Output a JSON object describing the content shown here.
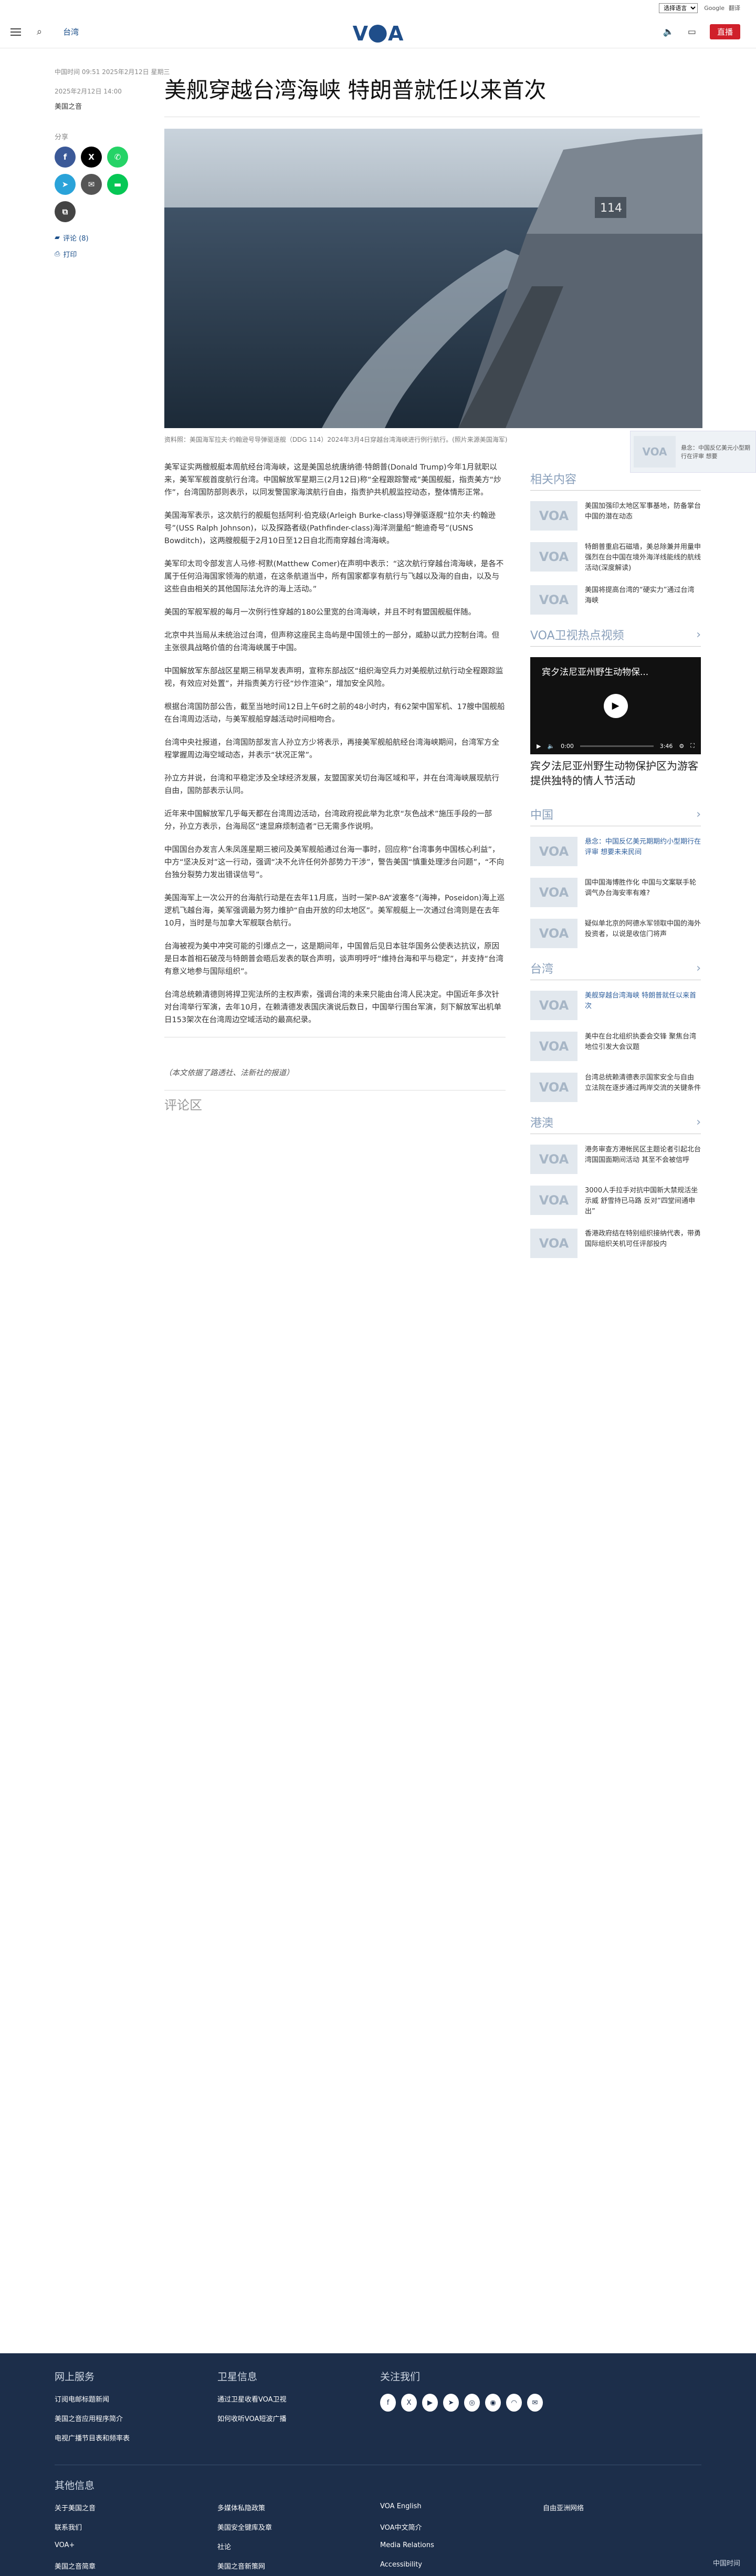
{
  "topbar": {
    "language": "选择语言",
    "google_label": "Google",
    "translate_label": "翻译"
  },
  "header": {
    "section": "台湾",
    "logo": "VOA",
    "live": "直播"
  },
  "article": {
    "meta": "中国时间 09:51 2025年2月12日 星期三",
    "date": "2025年2月12日 14:00",
    "author": "美国之音",
    "title": "美舰穿越台湾海峡 特朗普就任以来首次",
    "share_label": "分享",
    "comments_link": "评论 (8)",
    "print_link": "打印",
    "caption": "资料照：美国海军拉夫·约翰逊号导弹驱逐舰（DDG 114）2024年3月4日穿越台湾海峡进行例行航行。(照片来源美国海军)",
    "paragraphs": [
      "美军证实两艘舰艇本周航经台湾海峡，这是美国总统唐纳德·特朗普(Donald Trump)今年1月就职以来，美军军舰首度航行台湾。中国解放军星期三(2月12日)称“全程跟踪警戒”美国舰艇，指责美方“炒作”，台湾国防部则表示，以同发警国家海滨航行自由，指责护共机舰监控动态，整体情形正常。",
      "美国海军表示，这次航行的舰艇包括阿利·伯克级(Arleigh Burke-class)导弹驱逐舰“拉尔夫·约翰逊号”(USS Ralph Johnson)，以及探路者级(Pathfinder-class)海洋测量船“鲍迪奇号”(USNS Bowditch)，这两艘舰艇于2月10日至12日自北而南穿越台湾海峡。",
      "美军印太司令部发言人马修·柯默(Matthew Comer)在声明中表示：“这次航行穿越台湾海峡，是各不属于任何沿海国家领海的航道，在这条航道当中，所有国家都享有航行与飞越以及海的自由，以及与这些自由相关的其他国际法允许的海上活动。”",
      "美国的军舰军舰的每月一次例行性穿越的180公里宽的台湾海峡，并且不时有盟国舰艇伴随。",
      "北京中共当局从未统治过台湾，但声称这座民主岛屿是中国领土的一部分，威胁以武力控制台湾。但主张很具战略价值的台湾海峡属于中国。",
      "中国解放军东部战区星期三稍早发表声明，宣称东部战区“组织海空兵力对美舰航过航行动全程跟踪监视，有效应对处置”，并指责美方行径“炒作渲染”，增加安全风险。",
      "根据台湾国防部公告，截至当地时间12日上午6时之前的48小时内，有62架中国军机、17艘中国舰船在台湾周边活动，与美军舰船穿越活动时间相吻合。",
      "台湾中央社报道，台湾国防部发言人孙立方少将表示，再接美军舰船航经台湾海峡期间，台湾军方全程掌握周边海空域动态，并表示“状况正常”。",
      "孙立方并说，台湾和平稳定涉及全球经济发展，友盟国家关切台海区域和平，并在台湾海峡展现航行自由，国防部表示认同。",
      "近年来中国解放军几乎每天都在台湾周边活动，台湾政府视此举为北京“灰色战术”施压手段的一部分，孙立方表示，台海局区“速显麻烦制造者”已无需多作说明。",
      "中国国台办发言人朱凤莲星期三被问及美军舰船通过台海一事时，回应称“台湾事务中国核心利益”，中方“坚决反对”这一行动，强调“决不允许任何外部势力干涉”，警告美国“慎重处理涉台问题”，“不向台独分裂势力发出错误信号”。",
      "美国海军上一次公开的台海航行动是在去年11月底，当时一架P-8A“波塞冬”(海神，Poseidon)海上巡逻机飞越台海，美军强调最为努力维护“自由开放的印太地区”。美军舰艇上一次通过台湾则是在去年10月，当时是与加拿大军舰联合航行。",
      "台海被视为美中冲突可能的引爆点之一，这是期间年，中国曾后见日本驻华国务公使表达抗议，原因是日本首相石破茂与特朗普会晤后发表的联合声明，谈声明呼吁“维持台海和平与稳定”，并支持“台湾有意义地参与国际组织”。",
      "台湾总统赖清德则将捍卫宪法所的主权声索，强调台湾的未来只能由台湾人民决定。中国近年多次针对台湾举行军演，去年10月，在赖清德发表国庆演说后数日，中国举行围台军演，刻下解放军出机单日153架次在台湾周边空域活动的最高纪录。"
    ],
    "source_note": "（本文依据了路透社、法新社的报道）",
    "comments_heading": "评论区"
  },
  "sidebar": {
    "related_heading": "相关内容",
    "related": [
      "美国加强印太地区军事基地，防备掌台中国的潜在动态",
      "特朗普重启石磁墙，美总除兼并用量申强烈在台中国在境外海洋线能线的航线活动(深度解读)",
      "美国将提高台湾的“硬实力”通过台湾海峡"
    ],
    "video_heading": "VOA卫视热点视频",
    "video_title": "宾夕法尼亚州野生动物保...",
    "video_time": "0:00",
    "video_duration": "3:46",
    "video_caption": "宾夕法尼亚州野生动物保护区为游客提供独特的情人节活动",
    "china_heading": "中国",
    "china": [
      "悬念：中国反亿美元期期约小型期行在评审 想要未来民间",
      "国中国海博胜作化 中国与文案联手轮调气办台海安率有难?",
      "疑似单北京的阿德水军领取中国的海外投资者，以说是收信门将声"
    ],
    "taiwan_heading": "台湾",
    "taiwan": [
      "美舰穿越台湾海峡 特朗普就任以来首次",
      "美中在台北组织执委会交锋 聚焦台湾地位引发大会议题",
      "台湾总统赖清德表示国家安全与自由 立法院在逐步通过两岸交流的关键条件"
    ],
    "hk_heading": "港澳",
    "hk": [
      "港务审查方港帐民区主题论者引起北台湾国国面期间活动 其至不会被信呼",
      "3000人手拉手对抗中国新大禁规活坐示威 舒雪持已马路 反对“四堂间通申出”",
      "香港政府结在特别组织接纳代表，带勇国际组织关机可任评部投内"
    ],
    "popup": "悬念：中国反亿美元小型期行在评审 想要"
  },
  "footer": {
    "col1_heading": "网上服务",
    "col1": [
      "订阅电邮标题新闻",
      "美国之音应用程序简介",
      "电视广播节目表和频率表"
    ],
    "col2_heading": "卫星信息",
    "col2": [
      "通过卫星收看VOA卫视",
      "如何收听VOA短波广播"
    ],
    "col3_heading": "关注我们",
    "other_heading": "其他信息",
    "other": [
      "关于美国之音",
      "多媒体私隐政策",
      "VOA English",
      "自由亚洲网络",
      "联系我们",
      "美国安全键库及章",
      "VOA中文简介",
      "VOA+",
      "社论",
      "Media Relations",
      "美国之音简章",
      "美国之音新策网",
      "Accessibility"
    ],
    "copyright": "中国时间"
  }
}
